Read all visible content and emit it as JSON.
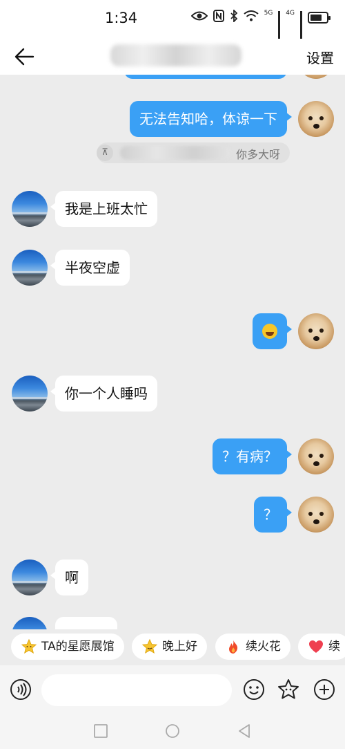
{
  "status_bar": {
    "time": "1:34",
    "network_5g": "5G",
    "network_4g": "4G"
  },
  "header": {
    "settings_label": "设置"
  },
  "messages": [
    {
      "side": "right",
      "text": "无法告知哈，体谅一下"
    },
    {
      "side": "quote",
      "text": "你多大呀"
    },
    {
      "side": "left",
      "text": "我是上班太忙"
    },
    {
      "side": "left",
      "text": "半夜空虚"
    },
    {
      "side": "right",
      "text": "",
      "emoji": "laughing-emoji"
    },
    {
      "side": "left",
      "text": "你一个人睡吗"
    },
    {
      "side": "right",
      "text": "？有病？"
    },
    {
      "side": "right",
      "text": "？"
    },
    {
      "side": "left",
      "text": "啊"
    }
  ],
  "quick_chips": [
    {
      "label": "TA的星愿展馆",
      "icon": "star-icon"
    },
    {
      "label": "晚上好",
      "icon": "star-smile-icon"
    },
    {
      "label": "续火花",
      "icon": "fire-icon"
    },
    {
      "label": "续",
      "icon": "heart-icon"
    }
  ],
  "input": {
    "placeholder": ""
  },
  "colors": {
    "accent": "#3aa0f5",
    "background": "#ececec"
  }
}
